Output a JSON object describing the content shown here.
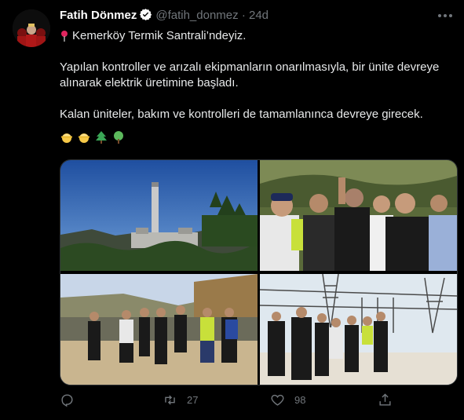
{
  "user": {
    "name": "Fatih Dönmez",
    "handle": "@fatih_donmez",
    "separator": "·",
    "time": "24d"
  },
  "tweet": {
    "line1": "Kemerköy Termik Santrali’ndeyiz.",
    "line2": "Yapılan kontroller ve arızalı ekipmanların onarılmasıyla, bir ünite devreye",
    "line3": "alınarak elektrik üretimine başladı.",
    "line4": "Kalan üniteler, bakım ve kontrolleri de tamamlanınca devreye girecek."
  },
  "icons": {
    "pin": "round-pushpin-icon",
    "emojis": [
      "construction-worker-icon",
      "construction-worker-icon",
      "evergreen-tree-icon",
      "deciduous-tree-icon"
    ],
    "more": "more-icon",
    "reply": "reply-icon",
    "retweet": "retweet-icon",
    "like": "heart-icon",
    "share": "share-icon"
  },
  "metrics": {
    "retweets": "27",
    "likes": "98"
  },
  "colors": {
    "background": "#000000",
    "text": "#e7e9ea",
    "muted": "#71767b",
    "verified": "#ffffff"
  }
}
